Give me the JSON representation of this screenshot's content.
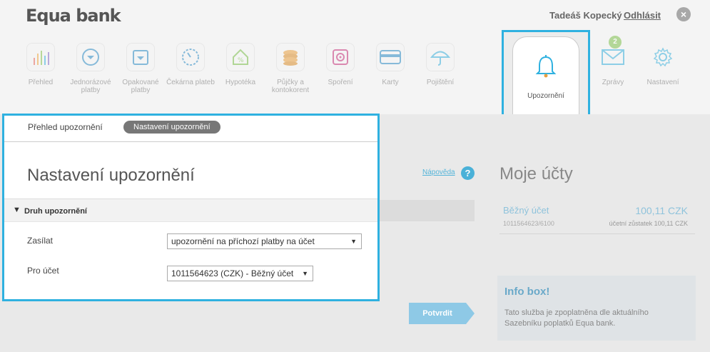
{
  "header": {
    "logo": "Equa bank",
    "user_name": "Tadeáš Kopecký",
    "logout_label": "Odhlásit",
    "logout_icon": "×"
  },
  "nav": {
    "items": [
      {
        "label": "Přehled",
        "icon": "bar-chart-icon"
      },
      {
        "label": "Jednorázové platby",
        "icon": "single-payment-icon"
      },
      {
        "label": "Opakované platby",
        "icon": "recurring-payment-icon"
      },
      {
        "label": "Čekárna plateb",
        "icon": "pending-payments-icon"
      },
      {
        "label": "Hypotéka",
        "icon": "mortgage-icon"
      },
      {
        "label": "Půjčky a kontokorent",
        "icon": "loans-icon"
      },
      {
        "label": "Spoření",
        "icon": "savings-icon"
      },
      {
        "label": "Karty",
        "icon": "card-icon"
      },
      {
        "label": "Pojištění",
        "icon": "insurance-icon"
      }
    ],
    "selected": {
      "label": "Upozornění",
      "icon": "bell-icon"
    },
    "messages": {
      "label": "Zprávy",
      "badge": "2",
      "icon": "envelope-icon"
    },
    "settings": {
      "label": "Nastavení",
      "icon": "gear-icon"
    }
  },
  "card": {
    "tabs": {
      "overview": "Přehled upozornění",
      "settings": "Nastavení upozornění"
    },
    "title": "Nastavení upozornění",
    "section_label": "Druh upozornění",
    "fields": {
      "send_label": "Zasílat",
      "send_value": "upozornění na příchozí platby na účet",
      "account_label": "Pro účet",
      "account_value": "1011564623 (CZK) - Běžný účet"
    }
  },
  "help_link": "Nápověda",
  "confirm_label": "Potvrdit",
  "accounts": {
    "title": "Moje účty",
    "items": [
      {
        "name": "Běžný účet",
        "amount": "100,11 CZK",
        "number": "1011564623/6100",
        "balance": "účetní zůstatek 100,11 CZK"
      }
    ]
  },
  "info": {
    "title": "Info box!",
    "text": "Tato služba je zpoplatněna dle aktuálního Sazebníku poplatků Equa bank."
  },
  "colors": {
    "accent": "#2fb1e0",
    "badge": "#7fc14d"
  }
}
